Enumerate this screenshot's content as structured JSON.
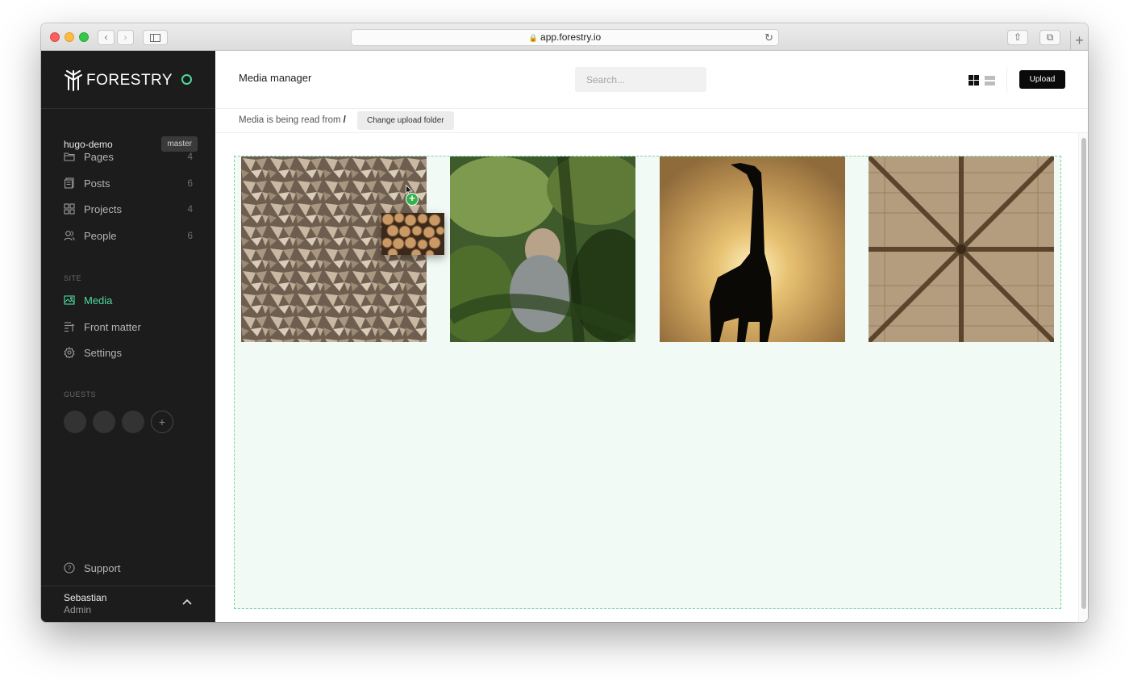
{
  "browser": {
    "url": "app.forestry.io"
  },
  "sidebar": {
    "brand": "FORESTRY",
    "repo": "hugo-demo",
    "branch": "master",
    "content_items": [
      {
        "label": "Pages",
        "count": "4",
        "icon": "folder-icon"
      },
      {
        "label": "Posts",
        "count": "6",
        "icon": "posts-icon"
      },
      {
        "label": "Projects",
        "count": "4",
        "icon": "grid-icon"
      },
      {
        "label": "People",
        "count": "6",
        "icon": "people-icon"
      }
    ],
    "site_section_label": "SITE",
    "site_items": [
      {
        "label": "Media",
        "icon": "image-icon",
        "active": true
      },
      {
        "label": "Front matter",
        "icon": "front-matter-icon"
      },
      {
        "label": "Settings",
        "icon": "gear-icon"
      }
    ],
    "guests_section_label": "GUESTS",
    "guests_add": "+",
    "support_label": "Support",
    "user": {
      "name": "Sebastian",
      "role": "Admin"
    },
    "accent_color": "#4ed89e"
  },
  "main": {
    "title": "Media manager",
    "search_placeholder": "Search...",
    "upload_label": "Upload",
    "read_from_text": "Media is being read from",
    "read_from_path": "/",
    "change_folder_label": "Change upload folder",
    "media_items": [
      {
        "subject": "stacked firewood logs"
      },
      {
        "subject": "man sitting in forest"
      },
      {
        "subject": "giraffe silhouette at sunset"
      },
      {
        "subject": "wooden roof beams"
      }
    ],
    "drag_badge": "+"
  }
}
